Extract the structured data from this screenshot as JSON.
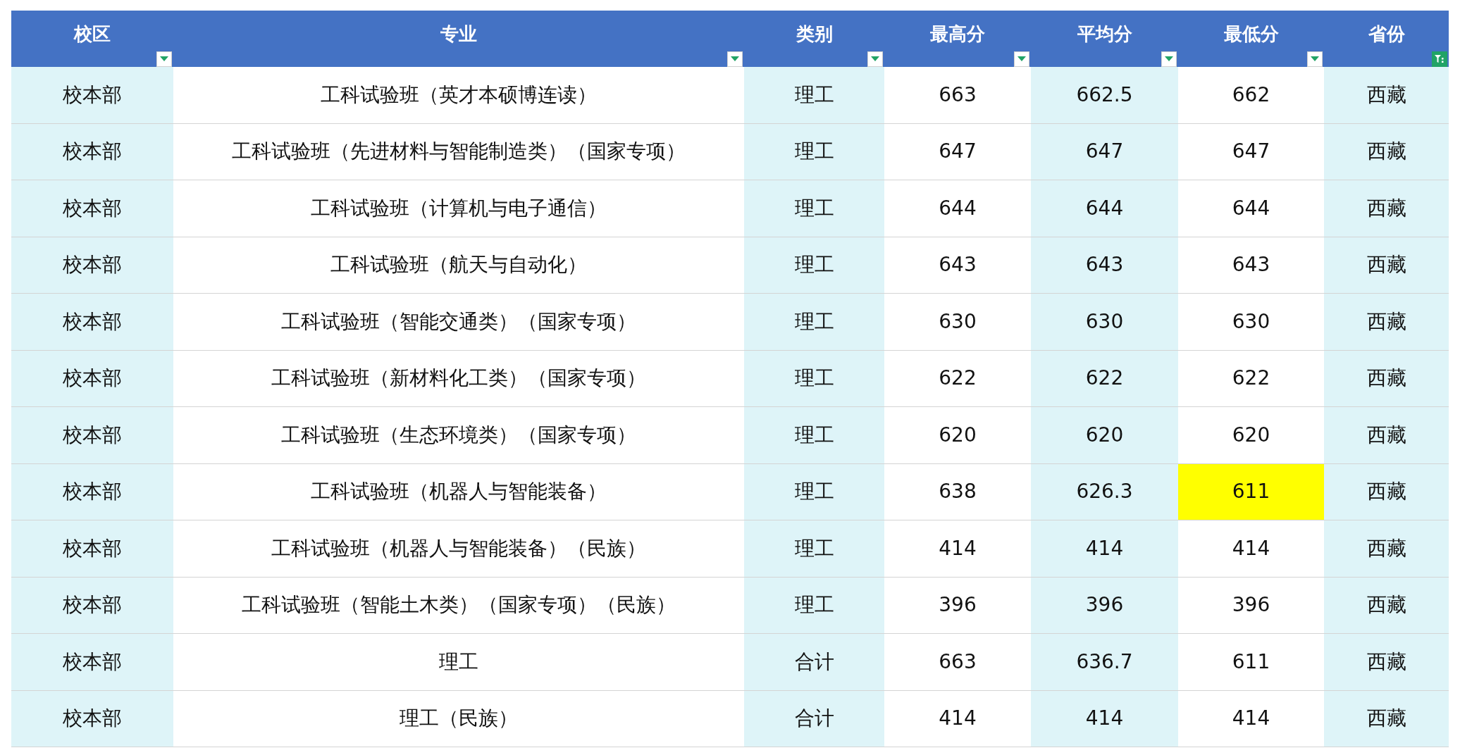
{
  "table": {
    "columns": [
      {
        "label": "校区",
        "filtered": false
      },
      {
        "label": "专业",
        "filtered": false
      },
      {
        "label": "类别",
        "filtered": false
      },
      {
        "label": "最高分",
        "filtered": false
      },
      {
        "label": "平均分",
        "filtered": false
      },
      {
        "label": "最低分",
        "filtered": false
      },
      {
        "label": "省份",
        "filtered": true
      }
    ],
    "rows": [
      [
        {
          "text": "校本部",
          "highlighted": false
        },
        {
          "text": "工科试验班（英才本硕博连读）",
          "highlighted": false
        },
        {
          "text": "理工",
          "highlighted": false
        },
        {
          "text": "663",
          "highlighted": false
        },
        {
          "text": "662.5",
          "highlighted": false
        },
        {
          "text": "662",
          "highlighted": false
        },
        {
          "text": "西藏",
          "highlighted": false
        }
      ],
      [
        {
          "text": "校本部",
          "highlighted": false
        },
        {
          "text": "工科试验班（先进材料与智能制造类）（国家专项）",
          "highlighted": false
        },
        {
          "text": "理工",
          "highlighted": false
        },
        {
          "text": "647",
          "highlighted": false
        },
        {
          "text": "647",
          "highlighted": false
        },
        {
          "text": "647",
          "highlighted": false
        },
        {
          "text": "西藏",
          "highlighted": false
        }
      ],
      [
        {
          "text": "校本部",
          "highlighted": false
        },
        {
          "text": "工科试验班（计算机与电子通信）",
          "highlighted": false
        },
        {
          "text": "理工",
          "highlighted": false
        },
        {
          "text": "644",
          "highlighted": false
        },
        {
          "text": "644",
          "highlighted": false
        },
        {
          "text": "644",
          "highlighted": false
        },
        {
          "text": "西藏",
          "highlighted": false
        }
      ],
      [
        {
          "text": "校本部",
          "highlighted": false
        },
        {
          "text": "工科试验班（航天与自动化）",
          "highlighted": false
        },
        {
          "text": "理工",
          "highlighted": false
        },
        {
          "text": "643",
          "highlighted": false
        },
        {
          "text": "643",
          "highlighted": false
        },
        {
          "text": "643",
          "highlighted": false
        },
        {
          "text": "西藏",
          "highlighted": false
        }
      ],
      [
        {
          "text": "校本部",
          "highlighted": false
        },
        {
          "text": "工科试验班（智能交通类）（国家专项）",
          "highlighted": false
        },
        {
          "text": "理工",
          "highlighted": false
        },
        {
          "text": "630",
          "highlighted": false
        },
        {
          "text": "630",
          "highlighted": false
        },
        {
          "text": "630",
          "highlighted": false
        },
        {
          "text": "西藏",
          "highlighted": false
        }
      ],
      [
        {
          "text": "校本部",
          "highlighted": false
        },
        {
          "text": "工科试验班（新材料化工类）（国家专项）",
          "highlighted": false
        },
        {
          "text": "理工",
          "highlighted": false
        },
        {
          "text": "622",
          "highlighted": false
        },
        {
          "text": "622",
          "highlighted": false
        },
        {
          "text": "622",
          "highlighted": false
        },
        {
          "text": "西藏",
          "highlighted": false
        }
      ],
      [
        {
          "text": "校本部",
          "highlighted": false
        },
        {
          "text": "工科试验班（生态环境类）（国家专项）",
          "highlighted": false
        },
        {
          "text": "理工",
          "highlighted": false
        },
        {
          "text": "620",
          "highlighted": false
        },
        {
          "text": "620",
          "highlighted": false
        },
        {
          "text": "620",
          "highlighted": false
        },
        {
          "text": "西藏",
          "highlighted": false
        }
      ],
      [
        {
          "text": "校本部",
          "highlighted": false
        },
        {
          "text": "工科试验班（机器人与智能装备）",
          "highlighted": false
        },
        {
          "text": "理工",
          "highlighted": false
        },
        {
          "text": "638",
          "highlighted": false
        },
        {
          "text": "626.3",
          "highlighted": false
        },
        {
          "text": "611",
          "highlighted": true
        },
        {
          "text": "西藏",
          "highlighted": false
        }
      ],
      [
        {
          "text": "校本部",
          "highlighted": false
        },
        {
          "text": "工科试验班（机器人与智能装备）（民族）",
          "highlighted": false
        },
        {
          "text": "理工",
          "highlighted": false
        },
        {
          "text": "414",
          "highlighted": false
        },
        {
          "text": "414",
          "highlighted": false
        },
        {
          "text": "414",
          "highlighted": false
        },
        {
          "text": "西藏",
          "highlighted": false
        }
      ],
      [
        {
          "text": "校本部",
          "highlighted": false
        },
        {
          "text": "工科试验班（智能土木类）（国家专项）（民族）",
          "highlighted": false
        },
        {
          "text": "理工",
          "highlighted": false
        },
        {
          "text": "396",
          "highlighted": false
        },
        {
          "text": "396",
          "highlighted": false
        },
        {
          "text": "396",
          "highlighted": false
        },
        {
          "text": "西藏",
          "highlighted": false
        }
      ],
      [
        {
          "text": "校本部",
          "highlighted": false
        },
        {
          "text": "理工",
          "highlighted": false
        },
        {
          "text": "合计",
          "highlighted": false
        },
        {
          "text": "663",
          "highlighted": false
        },
        {
          "text": "636.7",
          "highlighted": false
        },
        {
          "text": "611",
          "highlighted": false
        },
        {
          "text": "西藏",
          "highlighted": false
        }
      ],
      [
        {
          "text": "校本部",
          "highlighted": false
        },
        {
          "text": "理工（民族）",
          "highlighted": false
        },
        {
          "text": "合计",
          "highlighted": false
        },
        {
          "text": "414",
          "highlighted": false
        },
        {
          "text": "414",
          "highlighted": false
        },
        {
          "text": "414",
          "highlighted": false
        },
        {
          "text": "西藏",
          "highlighted": false
        }
      ]
    ]
  }
}
